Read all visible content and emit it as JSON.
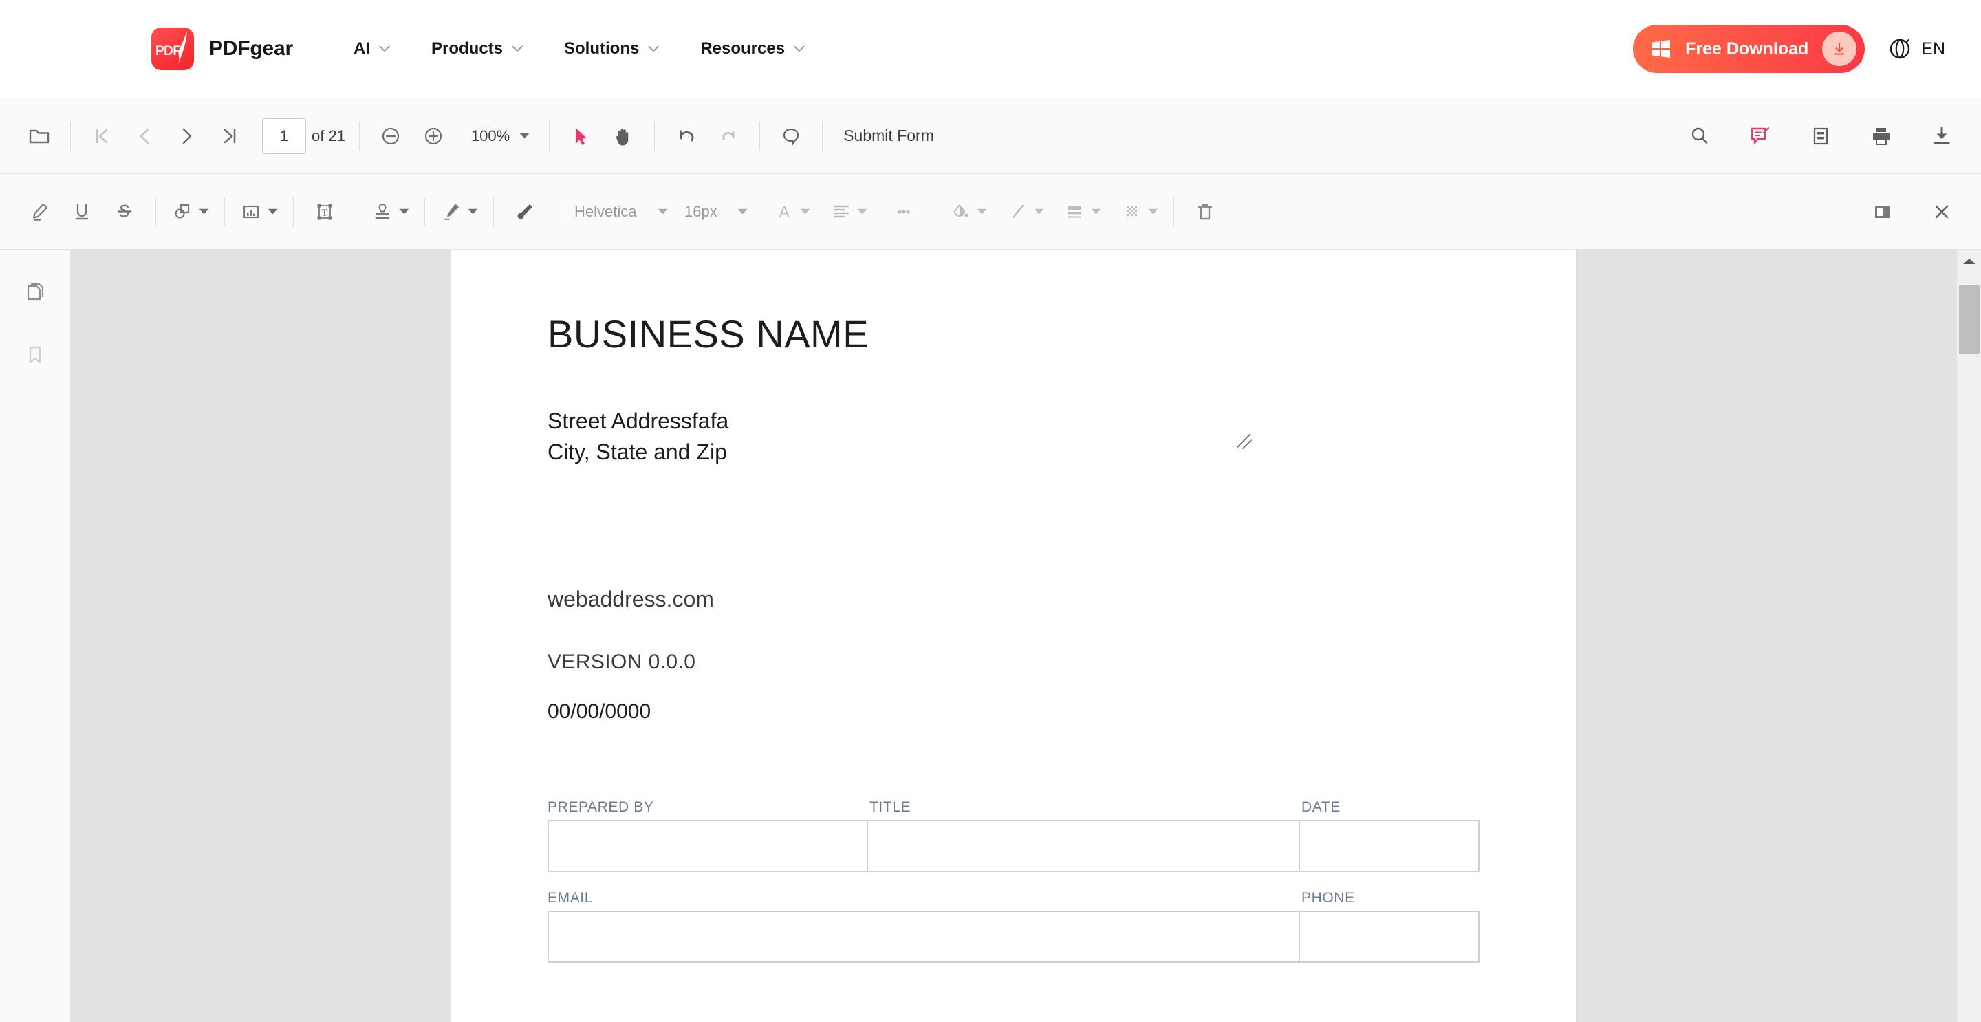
{
  "header": {
    "brand": {
      "logo_text": "PDF",
      "name": "PDFgear"
    },
    "nav": [
      {
        "label": "AI"
      },
      {
        "label": "Products"
      },
      {
        "label": "Solutions"
      },
      {
        "label": "Resources"
      }
    ],
    "download_button": {
      "label": "Free Download",
      "platform_icon": "windows-icon",
      "accent_color": "#fa3a46"
    },
    "language": {
      "label": "EN",
      "icon": "globe-icon"
    }
  },
  "toolbar": {
    "open_file": "open-folder-icon",
    "first_page": "first-page-icon",
    "prev_page": "prev-page-icon",
    "next_page": "next-page-icon",
    "last_page": "last-page-icon",
    "page_number": "1",
    "page_total": "of 21",
    "zoom_out": "zoom-out-icon",
    "zoom_in": "zoom-in-icon",
    "zoom_level": "100%",
    "select_tool": "cursor-icon",
    "hand_tool": "hand-icon",
    "undo": "undo-icon",
    "redo": "redo-icon",
    "comment": "comment-icon",
    "submit_form": "Submit Form",
    "search": "search-icon",
    "edit_annotation": "edit-comment-icon",
    "page_layout": "page-layout-icon",
    "print": "print-icon",
    "download": "download-icon",
    "accent_color": "#e8386a"
  },
  "toolbar2": {
    "highlight": "highlighter-icon",
    "underline": "underline-icon",
    "strikethrough": "strikethrough-icon",
    "shapes": "shapes-icon",
    "image": "image-icon",
    "text_box": "text-box-icon",
    "stamp": "stamp-icon",
    "signature": "signature-pen-icon",
    "brush": "brush-icon",
    "font_family": "Helvetica",
    "font_size": "16px",
    "text_color": "text-color-icon",
    "align": "align-icon",
    "more": "more-options-icon",
    "fill_color": "fill-color-icon",
    "line_style": "line-style-icon",
    "line_width": "line-width-icon",
    "opacity": "opacity-icon",
    "delete": "trash-icon",
    "toggle_panel": "toggle-side-panel-icon",
    "close": "close-icon"
  },
  "sidebar_rail": {
    "thumbnails": "page-thumbnails-icon",
    "bookmarks": "bookmark-icon"
  },
  "document": {
    "title": "BUSINESS NAME",
    "address_line1": "Street Addressfafa",
    "address_line2": "City, State and Zip",
    "website": "webaddress.com",
    "version": "VERSION 0.0.0",
    "date": "00/00/0000",
    "form": {
      "row1_labels": [
        "PREPARED BY",
        "TITLE",
        "DATE"
      ],
      "row1_values": [
        "",
        "",
        ""
      ],
      "row2_labels": [
        "EMAIL",
        "PHONE"
      ],
      "row2_values": [
        "",
        ""
      ]
    }
  },
  "scrollbar": {
    "up_arrow": "scroll-up-icon"
  }
}
